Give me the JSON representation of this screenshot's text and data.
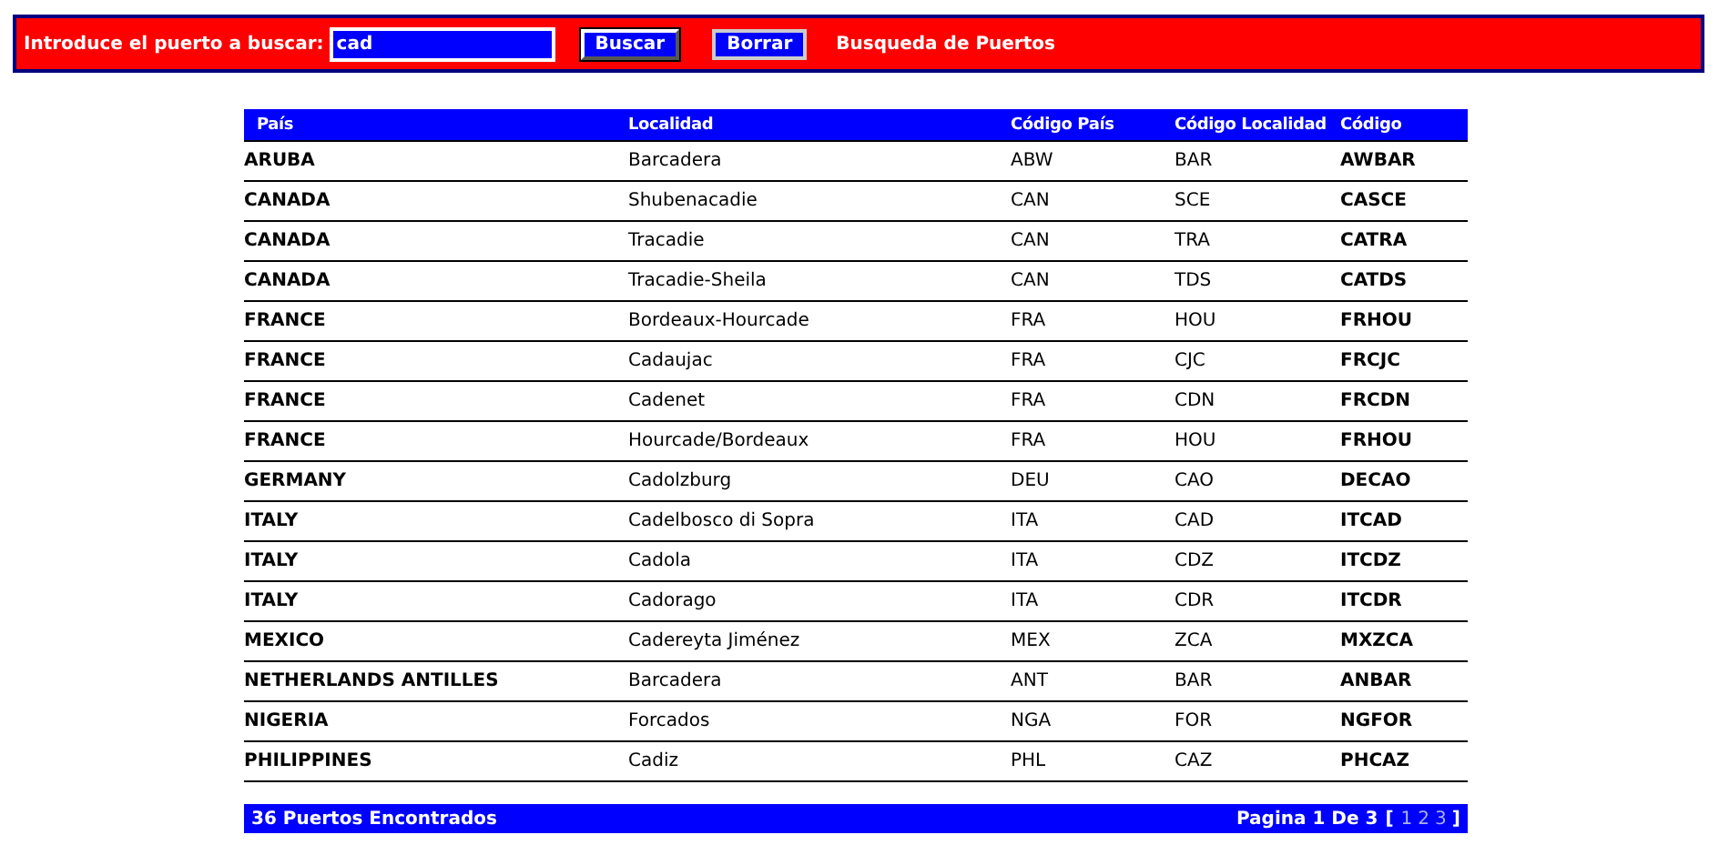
{
  "search": {
    "label": "Introduce el puerto a buscar:",
    "value": "cad",
    "buttons": [
      "Buscar",
      "Borrar"
    ],
    "title": "Busqueda de Puertos"
  },
  "table": {
    "columns": [
      "País",
      "Localidad",
      "Código País",
      "Código Localidad",
      "Código"
    ],
    "rows": [
      [
        "ARUBA",
        "Barcadera",
        "ABW",
        "BAR",
        "AWBAR"
      ],
      [
        "CANADA",
        "Shubenacadie",
        "CAN",
        "SCE",
        "CASCE"
      ],
      [
        "CANADA",
        "Tracadie",
        "CAN",
        "TRA",
        "CATRA"
      ],
      [
        "CANADA",
        "Tracadie-Sheila",
        "CAN",
        "TDS",
        "CATDS"
      ],
      [
        "FRANCE",
        "Bordeaux-Hourcade",
        "FRA",
        "HOU",
        "FRHOU"
      ],
      [
        "FRANCE",
        "Cadaujac",
        "FRA",
        "CJC",
        "FRCJC"
      ],
      [
        "FRANCE",
        "Cadenet",
        "FRA",
        "CDN",
        "FRCDN"
      ],
      [
        "FRANCE",
        "Hourcade/Bordeaux",
        "FRA",
        "HOU",
        "FRHOU"
      ],
      [
        "GERMANY",
        "Cadolzburg",
        "DEU",
        "CAO",
        "DECAO"
      ],
      [
        "ITALY",
        "Cadelbosco di Sopra",
        "ITA",
        "CAD",
        "ITCAD"
      ],
      [
        "ITALY",
        "Cadola",
        "ITA",
        "CDZ",
        "ITCDZ"
      ],
      [
        "ITALY",
        "Cadorago",
        "ITA",
        "CDR",
        "ITCDR"
      ],
      [
        "MEXICO",
        "Cadereyta Jiménez",
        "MEX",
        "ZCA",
        "MXZCA"
      ],
      [
        "NETHERLANDS ANTILLES",
        "Barcadera",
        "ANT",
        "BAR",
        "ANBAR"
      ],
      [
        "NIGERIA",
        "Forcados",
        "NGA",
        "FOR",
        "NGFOR"
      ],
      [
        "PHILIPPINES",
        "Cadiz",
        "PHL",
        "CAZ",
        "PHCAZ"
      ]
    ]
  },
  "footer": {
    "count": "36 Puertos Encontrados",
    "page_info": "Pagina 1 De 3",
    "open_bracket": "[",
    "pages": [
      "1",
      "2",
      "3"
    ],
    "close_bracket": "]"
  }
}
